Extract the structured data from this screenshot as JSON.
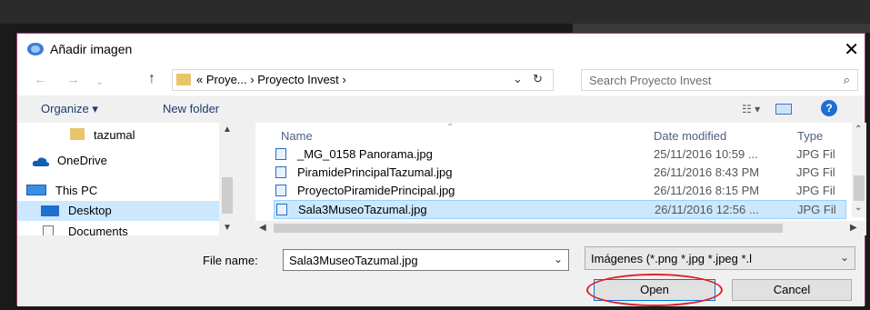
{
  "dialog": {
    "title": "Añadir imagen",
    "close_glyph": "✕"
  },
  "nav": {
    "back_glyph": "←",
    "forward_glyph": "→",
    "up_glyph": "↑"
  },
  "address": {
    "breadcrumb": "« Proye...  ›  Proyecto Invest  ›",
    "dropdown_glyph": "⌄",
    "refresh_glyph": "↻",
    "search_placeholder": "Search Proyecto Invest",
    "search_glyph": "⌕"
  },
  "toolbar": {
    "organize_label": "Organize ▾",
    "new_folder_label": "New folder",
    "view_glyph": "☷ ▾",
    "help_glyph": "?"
  },
  "navpane": {
    "items": [
      {
        "label": "tazumal",
        "icon": "folder-icon"
      },
      {
        "label": "OneDrive",
        "icon": "cloud-icon"
      },
      {
        "label": "This PC",
        "icon": "computer-icon"
      },
      {
        "label": "Desktop",
        "icon": "desktop-icon"
      },
      {
        "label": "Documents",
        "icon": "documents-icon"
      }
    ]
  },
  "files": {
    "columns": [
      "Name",
      "Date modified",
      "Type"
    ],
    "rows": [
      {
        "name": "_MG_0158 Panorama.jpg",
        "date": "25/11/2016 10:59 ...",
        "type": "JPG Fil"
      },
      {
        "name": "PiramidePrincipalTazumal.jpg",
        "date": "26/11/2016 8:43 PM",
        "type": "JPG Fil"
      },
      {
        "name": "ProyectoPiramidePrincipal.jpg",
        "date": "26/11/2016 8:15 PM",
        "type": "JPG Fil"
      },
      {
        "name": "Sala3MuseoTazumal.jpg",
        "date": "26/11/2016 12:56 ...",
        "type": "JPG Fil"
      }
    ]
  },
  "bottom": {
    "file_name_label": "File name:",
    "file_name_value": "Sala3MuseoTazumal.jpg",
    "file_type_value": "Imágenes (*.png *.jpg *.jpeg *.l",
    "open_label": "Open",
    "cancel_label": "Cancel"
  },
  "colors": {
    "selection": "#cce8ff",
    "accent": "#0078d7",
    "annotation": "#e0202a"
  }
}
